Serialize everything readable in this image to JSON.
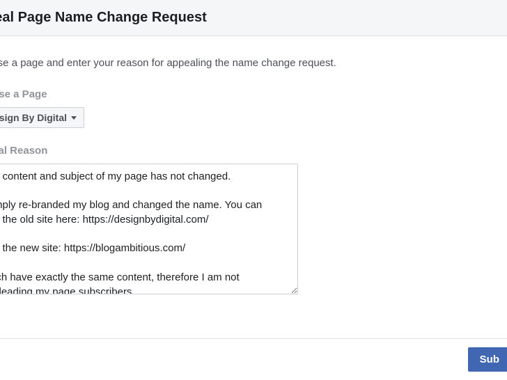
{
  "header": {
    "title": "peal Page Name Change Request"
  },
  "instructions": "oose a page and enter your reason for appealing the name change request.",
  "choosePage": {
    "label": "oose a Page",
    "selected": "esign By Digital"
  },
  "appealReason": {
    "label": "peal Reason",
    "value": "e content and subject of my page has not changed.\n\nmply re-branded my blog and changed the name. You can\ne the old site here: https://designbydigital.com/\n\nd the new site: https://blogambitious.com/\n\nich have exactly the same content, therefore I am not\nsleading my page subscribers."
  },
  "footer": {
    "submitLabel": "Sub"
  }
}
